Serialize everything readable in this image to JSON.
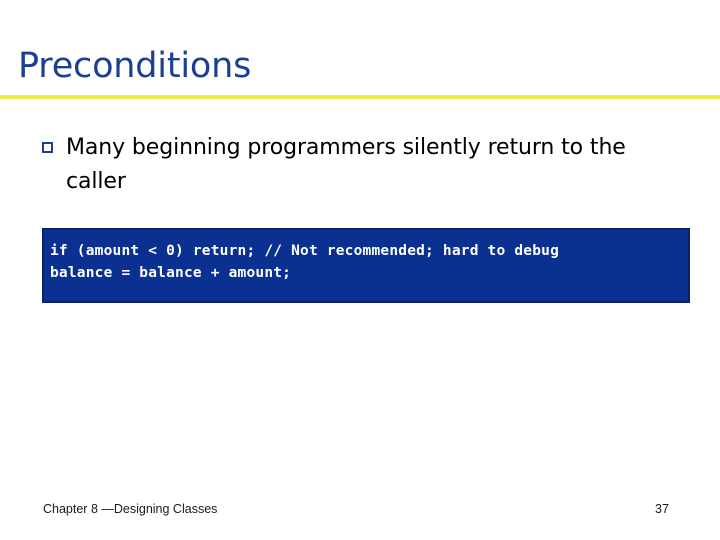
{
  "slide": {
    "title": "Preconditions",
    "title_color": "#1d3f92",
    "divider_color": "#f2e94e",
    "background_color": "#ffffff"
  },
  "content": {
    "bullets": [
      {
        "marker": "hollow-square-bullet",
        "text": "Many beginning programmers silently return to the caller"
      }
    ]
  },
  "code": {
    "background_color": "#0a3191",
    "border_color": "#0b2266",
    "text_color": "#ffffff",
    "lines": [
      "if (amount < 0) return; // Not recommended; hard to debug",
      "balance = balance + amount;"
    ]
  },
  "footer": {
    "chapter": "Chapter 8 —Designing Classes",
    "page_number": "37"
  }
}
